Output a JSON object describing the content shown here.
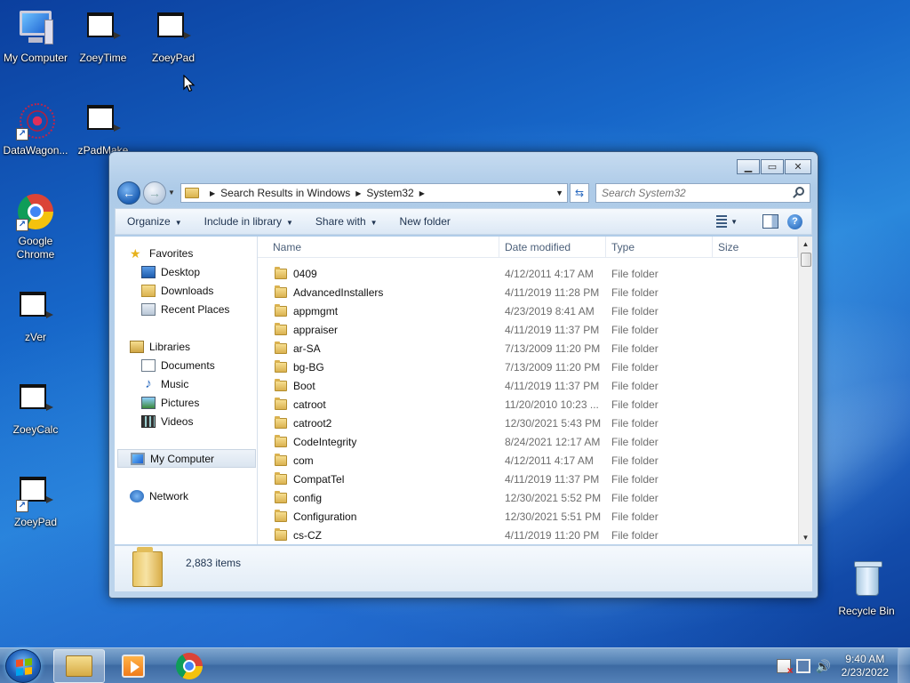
{
  "desktop": {
    "icons": [
      {
        "label": "My Computer"
      },
      {
        "label": "ZoeyTime"
      },
      {
        "label": "ZoeyPad"
      },
      {
        "label": "DataWagon..."
      },
      {
        "label": "zPadMake"
      },
      {
        "label": "Google Chrome"
      },
      {
        "label": "zVer"
      },
      {
        "label": "ZoeyCalc"
      },
      {
        "label": "ZoeyPad"
      },
      {
        "label": "Recycle Bin"
      }
    ]
  },
  "window": {
    "breadcrumb": [
      "Search Results in Windows",
      "System32"
    ],
    "search_placeholder": "Search System32",
    "toolbar": {
      "organize": "Organize",
      "include_in_library": "Include in library",
      "share_with": "Share with",
      "new_folder": "New folder"
    },
    "nav": {
      "favorites": "Favorites",
      "desktop": "Desktop",
      "downloads": "Downloads",
      "recent_places": "Recent Places",
      "libraries": "Libraries",
      "documents": "Documents",
      "music": "Music",
      "pictures": "Pictures",
      "videos": "Videos",
      "my_computer": "My Computer",
      "network": "Network"
    },
    "columns": {
      "name": "Name",
      "date": "Date modified",
      "type": "Type",
      "size": "Size"
    },
    "rows": [
      {
        "name": "0409",
        "date": "4/12/2011 4:17 AM",
        "type": "File folder"
      },
      {
        "name": "AdvancedInstallers",
        "date": "4/11/2019 11:28 PM",
        "type": "File folder"
      },
      {
        "name": "appmgmt",
        "date": "4/23/2019 8:41 AM",
        "type": "File folder"
      },
      {
        "name": "appraiser",
        "date": "4/11/2019 11:37 PM",
        "type": "File folder"
      },
      {
        "name": "ar-SA",
        "date": "7/13/2009 11:20 PM",
        "type": "File folder"
      },
      {
        "name": "bg-BG",
        "date": "7/13/2009 11:20 PM",
        "type": "File folder"
      },
      {
        "name": "Boot",
        "date": "4/11/2019 11:37 PM",
        "type": "File folder"
      },
      {
        "name": "catroot",
        "date": "11/20/2010 10:23 ...",
        "type": "File folder"
      },
      {
        "name": "catroot2",
        "date": "12/30/2021 5:43 PM",
        "type": "File folder"
      },
      {
        "name": "CodeIntegrity",
        "date": "8/24/2021 12:17 AM",
        "type": "File folder"
      },
      {
        "name": "com",
        "date": "4/12/2011 4:17 AM",
        "type": "File folder"
      },
      {
        "name": "CompatTel",
        "date": "4/11/2019 11:37 PM",
        "type": "File folder"
      },
      {
        "name": "config",
        "date": "12/30/2021 5:52 PM",
        "type": "File folder"
      },
      {
        "name": "Configuration",
        "date": "12/30/2021 5:51 PM",
        "type": "File folder"
      },
      {
        "name": "cs-CZ",
        "date": "4/11/2019 11:20 PM",
        "type": "File folder"
      }
    ],
    "status": "2,883 items"
  },
  "taskbar": {
    "clock_time": "9:40 AM",
    "clock_date": "2/23/2022"
  }
}
